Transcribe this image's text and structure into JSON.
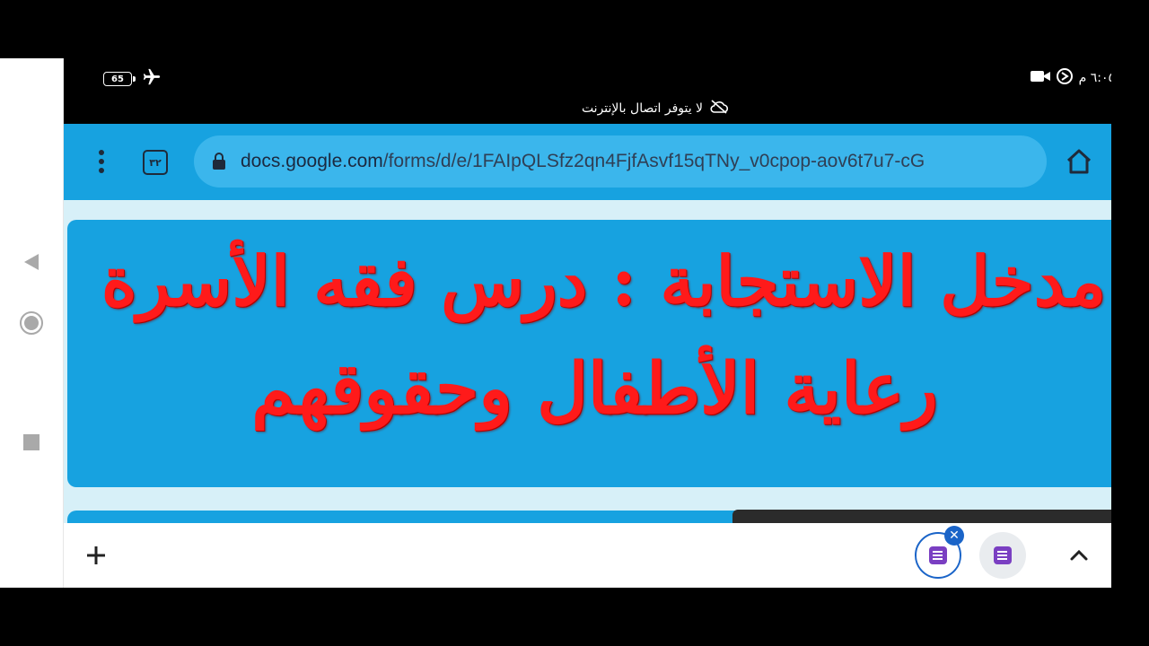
{
  "status": {
    "battery": "65",
    "time": "٦:٠٥ م"
  },
  "network": {
    "offline_message": "لا يتوفر اتصال بالإنترنت"
  },
  "browser": {
    "tab_count": "٣٢",
    "url_domain": "docs.google.com",
    "url_path": "/forms/d/e/1FAIpQLSfz2qn4FjfAsvf15qTNy_v0cpop-aov6t7u7-cG"
  },
  "form": {
    "title_line1": "مدخل الاستجابة : درس فقه الأسرة",
    "title_line2": "رعاية الأطفال وحقوقهم"
  },
  "colors": {
    "toolbar": "#17a2e0",
    "title_text": "#ff1a1a",
    "page_bg": "#d7f0f8",
    "active_tab_ring": "#1a64c8",
    "forms_icon": "#7a3fc2"
  },
  "icons": {
    "back": "triangle-left",
    "home": "circle",
    "recents": "square",
    "menu": "vertical-dots",
    "lock": "padlock",
    "browser_home": "house",
    "new_tab": "plus",
    "expand": "chevron-up"
  }
}
